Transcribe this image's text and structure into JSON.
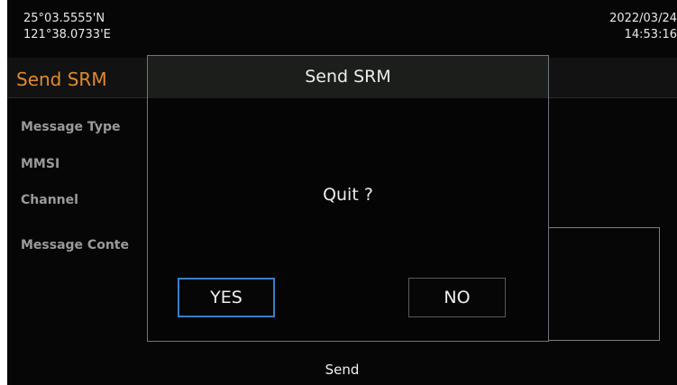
{
  "status_bar": {
    "latitude": "25°03.5555'N",
    "longitude": "121°38.0733'E",
    "date": "2022/03/24",
    "time": "14:53:16"
  },
  "page": {
    "title": "Send SRM",
    "title_color": "#e08a2e",
    "fields": {
      "message_type": "Message Type",
      "mmsi": "MMSI",
      "channel": "Channel",
      "message_content": "Message Conte"
    },
    "send_label": "Send"
  },
  "dialog": {
    "title": "Send SRM",
    "message": "Quit ?",
    "yes_label": "YES",
    "no_label": "NO",
    "focused_button": "YES",
    "focus_color": "#3a7fc6"
  }
}
